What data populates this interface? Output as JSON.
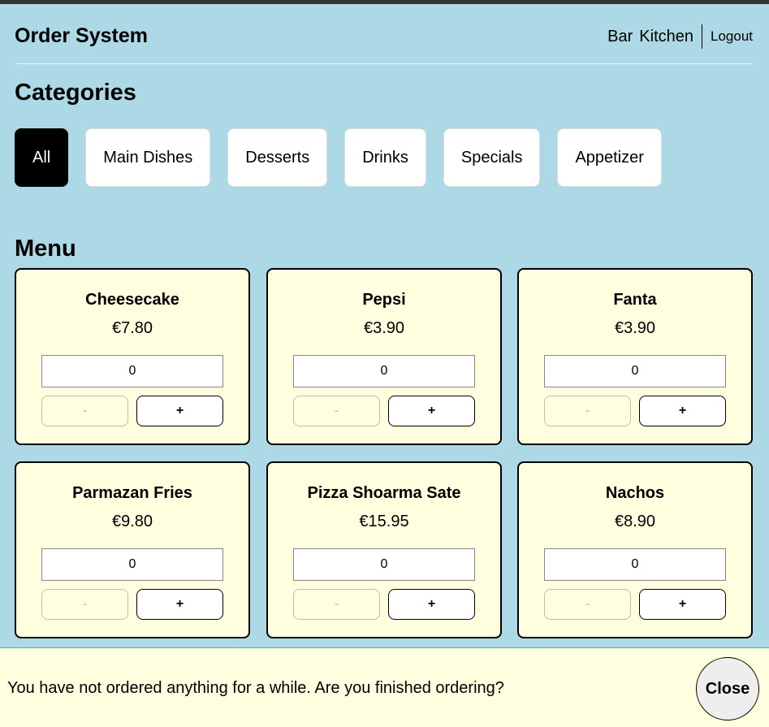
{
  "header": {
    "title": "Order System",
    "nav": {
      "bar": "Bar",
      "kitchen": "Kitchen",
      "logout": "Logout"
    }
  },
  "categories": {
    "title": "Categories",
    "items": [
      "All",
      "Main Dishes",
      "Desserts",
      "Drinks",
      "Specials",
      "Appetizer"
    ],
    "active": "All"
  },
  "menu": {
    "title": "Menu",
    "items": [
      {
        "name": "Cheesecake",
        "price": "€7.80",
        "qty": "0",
        "minus": "-",
        "plus": "+"
      },
      {
        "name": "Pepsi",
        "price": "€3.90",
        "qty": "0",
        "minus": "-",
        "plus": "+"
      },
      {
        "name": "Fanta",
        "price": "€3.90",
        "qty": "0",
        "minus": "-",
        "plus": "+"
      },
      {
        "name": "Parmazan Fries",
        "price": "€9.80",
        "qty": "0",
        "minus": "-",
        "plus": "+"
      },
      {
        "name": "Pizza Shoarma Sate",
        "price": "€15.95",
        "qty": "0",
        "minus": "-",
        "plus": "+"
      },
      {
        "name": "Nachos",
        "price": "€8.90",
        "qty": "0",
        "minus": "-",
        "plus": "+"
      }
    ]
  },
  "footer": {
    "message": "You have not ordered anything for a while. Are you finished ordering?",
    "close_label": "Close"
  },
  "colors": {
    "background": "#add8e6",
    "card": "#ffffe0",
    "active_category": "#000000"
  }
}
